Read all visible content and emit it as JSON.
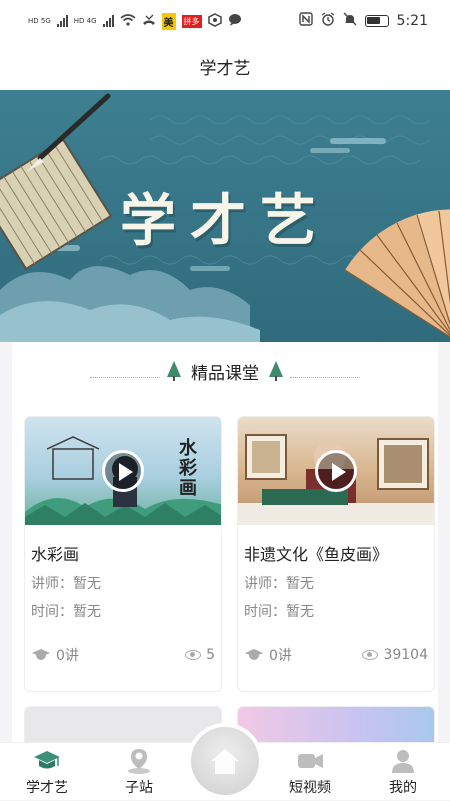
{
  "status_bar": {
    "network_1": "HD 5G",
    "network_2": "HD 4G",
    "app_badge_1": "美",
    "app_badge_2": "拼多",
    "time": "5:21"
  },
  "header": {
    "title": "学才艺"
  },
  "banner": {
    "title": "学才艺"
  },
  "section": {
    "title": "精品课堂"
  },
  "courses": [
    {
      "title": "水彩画",
      "teacher": "讲师：暂无",
      "time": "时间：暂无",
      "lectures": "0讲",
      "views": "5",
      "thumb_text": "水彩画"
    },
    {
      "title": "非遗文化《鱼皮画》",
      "teacher": "讲师：暂无",
      "time": "时间：暂无",
      "lectures": "0讲",
      "views": "39104"
    }
  ],
  "tabbar": {
    "items": [
      {
        "label": "学才艺",
        "icon": "graduation-cap-icon",
        "active": true
      },
      {
        "label": "子站",
        "icon": "location-person-icon",
        "active": false
      },
      {
        "label": "",
        "icon": "home-icon",
        "active": false
      },
      {
        "label": "短视频",
        "icon": "video-camera-icon",
        "active": false
      },
      {
        "label": "我的",
        "icon": "user-icon",
        "active": false
      }
    ]
  },
  "colors": {
    "accent": "#3e8f7a",
    "banner_bg": "#3e7f92",
    "muted_text": "#888888"
  }
}
